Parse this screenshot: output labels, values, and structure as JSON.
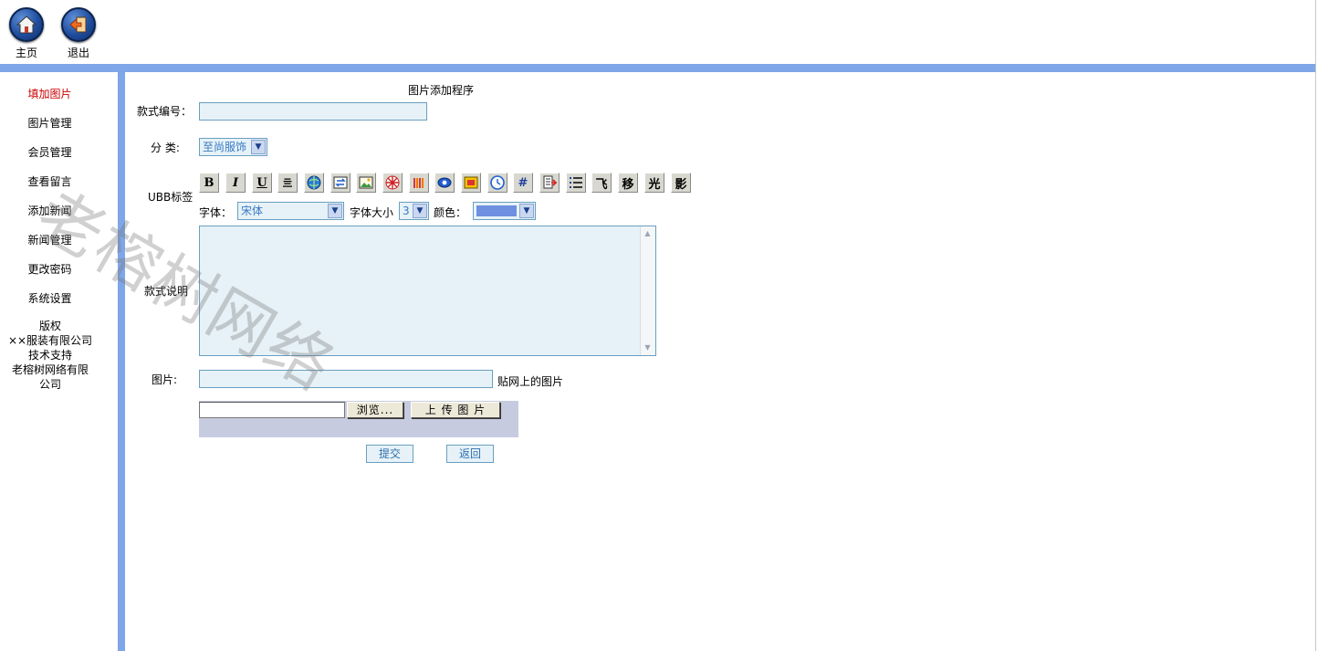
{
  "top_nav": {
    "home_label": "主页",
    "exit_label": "退出"
  },
  "sidebar": {
    "items": [
      {
        "label": "填加图片",
        "active": true
      },
      {
        "label": "图片管理"
      },
      {
        "label": "会员管理"
      },
      {
        "label": "查看留言"
      },
      {
        "label": "添加新闻"
      },
      {
        "label": "新闻管理"
      },
      {
        "label": "更改密码"
      },
      {
        "label": "系统设置"
      }
    ],
    "copyright": {
      "title": "版权",
      "company": "××服装有限公司",
      "support_label": "技术支持",
      "support_company": "老榕树网络有限公司"
    }
  },
  "watermark": {
    "text": "老榕树网络"
  },
  "form": {
    "title": "图片添加程序",
    "style_no_label": "款式编号：",
    "style_no_value": "",
    "category_label": "分 类:",
    "category_value": "至尚服饰",
    "ubb_label": "UBB标签",
    "ubb_buttons": [
      "B",
      "I",
      "U",
      "亖",
      "globe-icon",
      "swap-icon",
      "image-icon",
      "flash-icon",
      "media-icon",
      "eye-icon",
      "quote-icon",
      "clock-icon",
      "#",
      "page-icon",
      "list-icon",
      "飞",
      "移",
      "光",
      "影"
    ],
    "font_label": "字体：",
    "font_value": "宋体",
    "size_label": "字体大小",
    "size_value": "3",
    "color_label": "颜色：",
    "color_value": "#6f8fe0",
    "desc_label": "款式说明",
    "desc_value": "",
    "image_label": "图片:",
    "image_value": "",
    "image_hint": "贴网上的图片",
    "browse_label": "浏览...",
    "upload_label": "上 传 图 片",
    "submit_label": "提交",
    "back_label": "返回"
  }
}
